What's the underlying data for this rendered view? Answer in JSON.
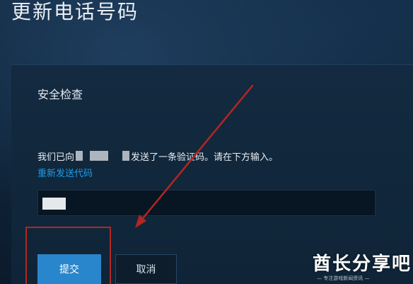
{
  "header": {
    "title": "更新电话号码"
  },
  "security_check": {
    "title": "安全检查",
    "notice_prefix": "我们已向",
    "notice_suffix": "发送了一条验证码。请在下方输入。",
    "resend_label": "重新发送代码"
  },
  "code_field": {
    "value": "",
    "value_redacted": true
  },
  "actions": {
    "submit_label": "提交",
    "cancel_label": "取消"
  },
  "annotations": {
    "highlight_color": "#b32621",
    "arrow_color": "#b32621"
  },
  "watermark": {
    "main_text": "酋长分享吧",
    "sub_text": "— 专注游戏新闻资讯 —"
  },
  "colors": {
    "background": "#0e2236",
    "primary_button": "#2a86cc",
    "link": "#1d9ce7"
  }
}
